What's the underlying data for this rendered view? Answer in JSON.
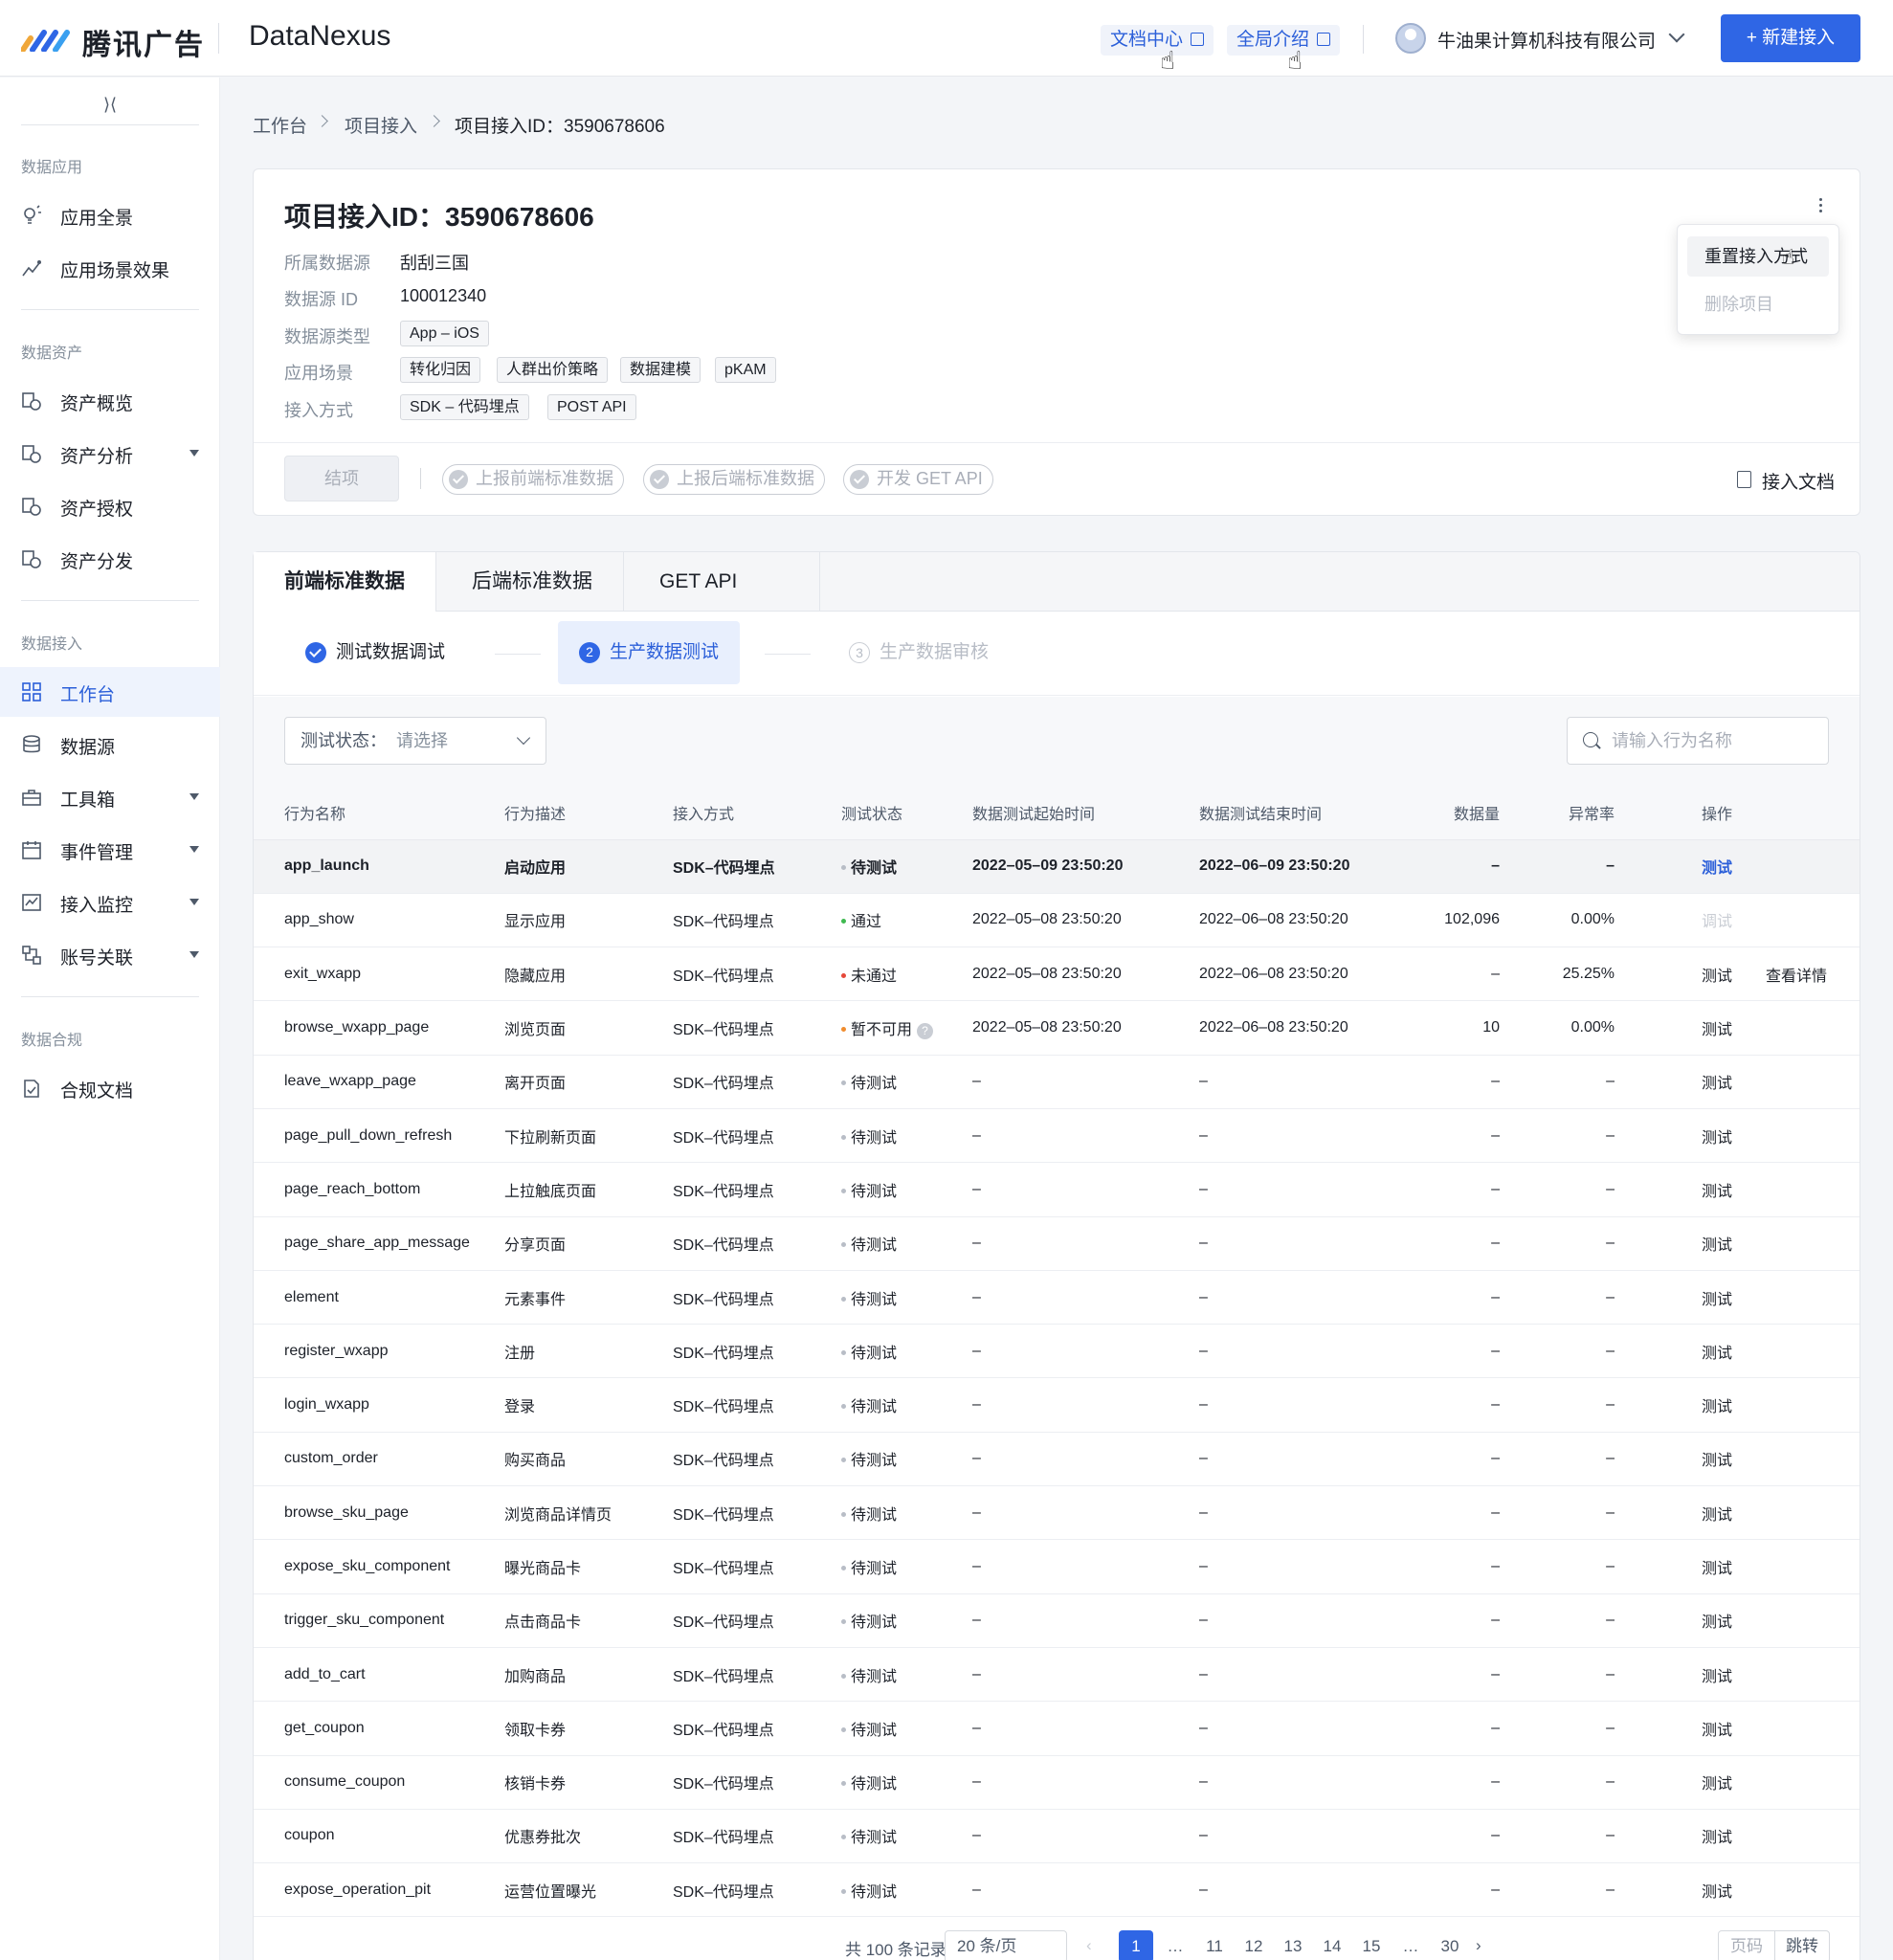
{
  "topbar": {
    "brand": "腾讯广告",
    "product": "DataNexus",
    "doc_center": "文档中心",
    "global_intro": "全局介绍",
    "company": "牛油果计算机科技有限公司",
    "new_button": "+ 新建接入"
  },
  "sidebar": {
    "collapse_icon": "⟩⟨",
    "sections": [
      {
        "title": "数据应用",
        "items": [
          {
            "label": "应用全景",
            "icon": "bulb-icon"
          },
          {
            "label": "应用场景效果",
            "icon": "trend-icon"
          }
        ]
      },
      {
        "title": "数据资产",
        "items": [
          {
            "label": "资产概览",
            "icon": "asset-icon"
          },
          {
            "label": "资产分析",
            "icon": "asset-icon",
            "expandable": true
          },
          {
            "label": "资产授权",
            "icon": "asset-icon"
          },
          {
            "label": "资产分发",
            "icon": "asset-icon"
          }
        ]
      },
      {
        "title": "数据接入",
        "items": [
          {
            "label": "工作台",
            "icon": "grid-icon",
            "active": true
          },
          {
            "label": "数据源",
            "icon": "database-icon"
          },
          {
            "label": "工具箱",
            "icon": "toolbox-icon",
            "expandable": true
          },
          {
            "label": "事件管理",
            "icon": "calendar-icon",
            "expandable": true
          },
          {
            "label": "接入监控",
            "icon": "monitor-icon",
            "expandable": true
          },
          {
            "label": "账号关联",
            "icon": "link-icon",
            "expandable": true
          }
        ]
      },
      {
        "title": "数据合规",
        "items": [
          {
            "label": "合规文档",
            "icon": "compliance-icon"
          }
        ]
      }
    ]
  },
  "breadcrumb": [
    "工作台",
    "项目接入",
    "项目接入ID：3590678606"
  ],
  "project": {
    "title": "项目接入ID：3590678606",
    "labels": {
      "source": "所属数据源",
      "source_id": "数据源 ID",
      "source_type": "数据源类型",
      "scenario": "应用场景",
      "method": "接入方式"
    },
    "source": "刮刮三国",
    "source_id": "100012340",
    "source_type": "App – iOS",
    "scenarios": [
      "转化归因",
      "人群出价策略",
      "数据建模",
      "pKAM"
    ],
    "methods": [
      "SDK – 代码埋点",
      "POST API"
    ],
    "close_button": "结项",
    "stages": [
      "上报前端标准数据",
      "上报后端标准数据",
      "开发 GET API"
    ],
    "doc_link": "接入文档",
    "menu": {
      "reset": "重置接入方式",
      "delete": "删除项目"
    }
  },
  "tabs": [
    "前端标准数据",
    "后端标准数据",
    "GET API"
  ],
  "steps": [
    {
      "num": "",
      "label": "测试数据调试",
      "state": "done"
    },
    {
      "num": "2",
      "label": "生产数据测试",
      "state": "current"
    },
    {
      "num": "3",
      "label": "生产数据审核",
      "state": "todo"
    }
  ],
  "filter": {
    "status_label": "测试状态：",
    "status_placeholder": "请选择",
    "search_placeholder": "请输入行为名称"
  },
  "colors": {
    "pending": "#b8bdc6",
    "pass": "#3fb950",
    "fail": "#e5483a",
    "unavailable": "#f08c2e",
    "accent": "#2f66e5"
  },
  "table": {
    "headers": [
      "行为名称",
      "行为描述",
      "接入方式",
      "测试状态",
      "数据测试起始时间",
      "数据测试结束时间",
      "数据量",
      "异常率",
      "操作"
    ],
    "rows": [
      {
        "name": "app_launch",
        "desc": "启动应用",
        "method": "SDK–代码埋点",
        "status": "待测试",
        "status_color": "#b8bdc6",
        "start": "2022–05–09 23:50:20",
        "end": "2022–06–09 23:50:20",
        "volume": "–",
        "rate": "–",
        "op": "测试",
        "op_style": "blue",
        "highlight": true
      },
      {
        "name": "app_show",
        "desc": "显示应用",
        "method": "SDK–代码埋点",
        "status": "通过",
        "status_color": "#3fb950",
        "start": "2022–05–08 23:50:20",
        "end": "2022–06–08 23:50:20",
        "volume": "102,096",
        "rate": "0.00%",
        "op": "调试",
        "op_style": "dis"
      },
      {
        "name": "exit_wxapp",
        "desc": "隐藏应用",
        "method": "SDK–代码埋点",
        "status": "未通过",
        "status_color": "#e5483a",
        "start": "2022–05–08 23:50:20",
        "end": "2022–06–08 23:50:20",
        "volume": "–",
        "rate": "25.25%",
        "op": "测试",
        "op2": "查看详情"
      },
      {
        "name": "browse_wxapp_page",
        "desc": "浏览页面",
        "method": "SDK–代码埋点",
        "status": "暂不可用",
        "status_color": "#f08c2e",
        "help": true,
        "start": "2022–05–08 23:50:20",
        "end": "2022–06–08 23:50:20",
        "volume": "10",
        "rate": "0.00%",
        "op": "测试"
      },
      {
        "name": "leave_wxapp_page",
        "desc": "离开页面",
        "method": "SDK–代码埋点",
        "status": "待测试",
        "status_color": "#b8bdc6",
        "start": "–",
        "end": "–",
        "volume": "–",
        "rate": "–",
        "op": "测试"
      },
      {
        "name": "page_pull_down_refresh",
        "desc": "下拉刷新页面",
        "method": "SDK–代码埋点",
        "status": "待测试",
        "status_color": "#b8bdc6",
        "start": "–",
        "end": "–",
        "volume": "–",
        "rate": "–",
        "op": "测试"
      },
      {
        "name": "page_reach_bottom",
        "desc": "上拉触底页面",
        "method": "SDK–代码埋点",
        "status": "待测试",
        "status_color": "#b8bdc6",
        "start": "–",
        "end": "–",
        "volume": "–",
        "rate": "–",
        "op": "测试"
      },
      {
        "name": "page_share_app_message",
        "desc": "分享页面",
        "method": "SDK–代码埋点",
        "status": "待测试",
        "status_color": "#b8bdc6",
        "start": "–",
        "end": "–",
        "volume": "–",
        "rate": "–",
        "op": "测试"
      },
      {
        "name": "element",
        "desc": "元素事件",
        "method": "SDK–代码埋点",
        "status": "待测试",
        "status_color": "#b8bdc6",
        "start": "–",
        "end": "–",
        "volume": "–",
        "rate": "–",
        "op": "测试"
      },
      {
        "name": "register_wxapp",
        "desc": "注册",
        "method": "SDK–代码埋点",
        "status": "待测试",
        "status_color": "#b8bdc6",
        "start": "–",
        "end": "–",
        "volume": "–",
        "rate": "–",
        "op": "测试"
      },
      {
        "name": "login_wxapp",
        "desc": "登录",
        "method": "SDK–代码埋点",
        "status": "待测试",
        "status_color": "#b8bdc6",
        "start": "–",
        "end": "–",
        "volume": "–",
        "rate": "–",
        "op": "测试"
      },
      {
        "name": "custom_order",
        "desc": "购买商品",
        "method": "SDK–代码埋点",
        "status": "待测试",
        "status_color": "#b8bdc6",
        "start": "–",
        "end": "–",
        "volume": "–",
        "rate": "–",
        "op": "测试"
      },
      {
        "name": "browse_sku_page",
        "desc": "浏览商品详情页",
        "method": "SDK–代码埋点",
        "status": "待测试",
        "status_color": "#b8bdc6",
        "start": "–",
        "end": "–",
        "volume": "–",
        "rate": "–",
        "op": "测试"
      },
      {
        "name": "expose_sku_component",
        "desc": "曝光商品卡",
        "method": "SDK–代码埋点",
        "status": "待测试",
        "status_color": "#b8bdc6",
        "start": "–",
        "end": "–",
        "volume": "–",
        "rate": "–",
        "op": "测试"
      },
      {
        "name": "trigger_sku_component",
        "desc": "点击商品卡",
        "method": "SDK–代码埋点",
        "status": "待测试",
        "status_color": "#b8bdc6",
        "start": "–",
        "end": "–",
        "volume": "–",
        "rate": "–",
        "op": "测试"
      },
      {
        "name": "add_to_cart",
        "desc": "加购商品",
        "method": "SDK–代码埋点",
        "status": "待测试",
        "status_color": "#b8bdc6",
        "start": "–",
        "end": "–",
        "volume": "–",
        "rate": "–",
        "op": "测试"
      },
      {
        "name": "get_coupon",
        "desc": "领取卡券",
        "method": "SDK–代码埋点",
        "status": "待测试",
        "status_color": "#b8bdc6",
        "start": "–",
        "end": "–",
        "volume": "–",
        "rate": "–",
        "op": "测试"
      },
      {
        "name": "consume_coupon",
        "desc": "核销卡券",
        "method": "SDK–代码埋点",
        "status": "待测试",
        "status_color": "#b8bdc6",
        "start": "–",
        "end": "–",
        "volume": "–",
        "rate": "–",
        "op": "测试"
      },
      {
        "name": "coupon",
        "desc": "优惠券批次",
        "method": "SDK–代码埋点",
        "status": "待测试",
        "status_color": "#b8bdc6",
        "start": "–",
        "end": "–",
        "volume": "–",
        "rate": "–",
        "op": "测试"
      },
      {
        "name": "expose_operation_pit",
        "desc": "运营位置曝光",
        "method": "SDK–代码埋点",
        "status": "待测试",
        "status_color": "#b8bdc6",
        "start": "–",
        "end": "–",
        "volume": "–",
        "rate": "–",
        "op": "测试"
      }
    ]
  },
  "pagination": {
    "total": "共 100 条记录",
    "page_size": "20 条/页",
    "pages": [
      "1",
      "…",
      "11",
      "12",
      "13",
      "14",
      "15",
      "…",
      "30"
    ],
    "current": "1",
    "goto_label": "页码",
    "jump": "跳转"
  }
}
